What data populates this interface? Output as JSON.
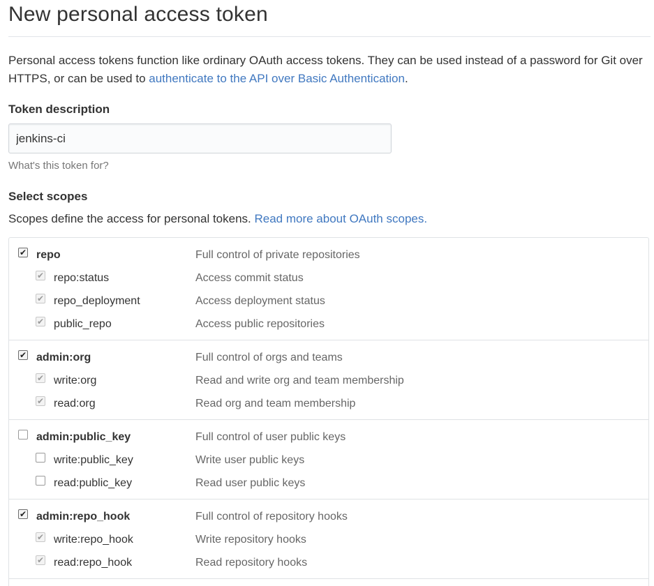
{
  "page": {
    "title": "New personal access token",
    "intro_text": "Personal access tokens function like ordinary OAuth access tokens. They can be used instead of a password for Git over HTTPS, or can be used to ",
    "intro_link": "authenticate to the API over Basic Authentication",
    "intro_end": "."
  },
  "description": {
    "label": "Token description",
    "value": "jenkins-ci",
    "note": "What's this token for?"
  },
  "scopes": {
    "label": "Select scopes",
    "intro_text": "Scopes define the access for personal tokens. ",
    "intro_link": "Read more about OAuth scopes.",
    "groups": [
      {
        "name": "repo",
        "desc": "Full control of private repositories",
        "checked": true,
        "children": [
          {
            "name": "repo:status",
            "desc": "Access commit status",
            "checked": true
          },
          {
            "name": "repo_deployment",
            "desc": "Access deployment status",
            "checked": true
          },
          {
            "name": "public_repo",
            "desc": "Access public repositories",
            "checked": true
          }
        ]
      },
      {
        "name": "admin:org",
        "desc": "Full control of orgs and teams",
        "checked": true,
        "children": [
          {
            "name": "write:org",
            "desc": "Read and write org and team membership",
            "checked": true
          },
          {
            "name": "read:org",
            "desc": "Read org and team membership",
            "checked": true
          }
        ]
      },
      {
        "name": "admin:public_key",
        "desc": "Full control of user public keys",
        "checked": false,
        "children": [
          {
            "name": "write:public_key",
            "desc": "Write user public keys",
            "checked": false
          },
          {
            "name": "read:public_key",
            "desc": "Read user public keys",
            "checked": false
          }
        ]
      },
      {
        "name": "admin:repo_hook",
        "desc": "Full control of repository hooks",
        "checked": true,
        "children": [
          {
            "name": "write:repo_hook",
            "desc": "Write repository hooks",
            "checked": true
          },
          {
            "name": "read:repo_hook",
            "desc": "Read repository hooks",
            "checked": true
          }
        ]
      }
    ]
  }
}
